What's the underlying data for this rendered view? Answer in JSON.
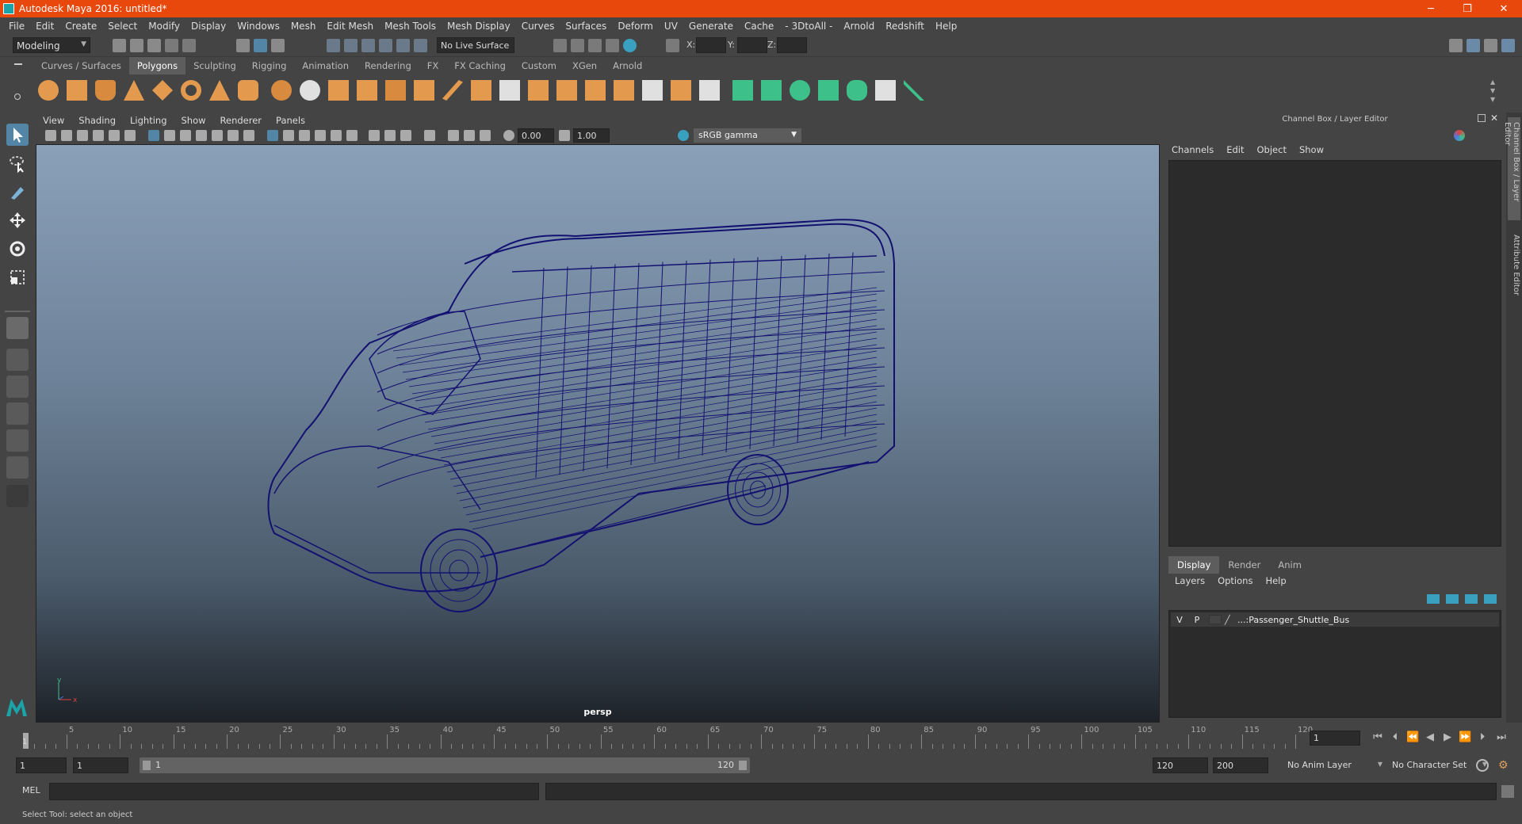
{
  "window": {
    "title": "Autodesk Maya 2016: untitled*",
    "min": "─",
    "restore": "❐",
    "close": "✕"
  },
  "menubar": [
    "File",
    "Edit",
    "Create",
    "Select",
    "Modify",
    "Display",
    "Windows",
    "Mesh",
    "Edit Mesh",
    "Mesh Tools",
    "Mesh Display",
    "Curves",
    "Surfaces",
    "Deform",
    "UV",
    "Generate",
    "Cache",
    "- 3DtoAll -",
    "Arnold",
    "Redshift",
    "Help"
  ],
  "statusline": {
    "mode": "Modeling",
    "live_surface": "No Live Surface",
    "x_label": "X:",
    "y_label": "Y:",
    "z_label": "Z:"
  },
  "shelf": {
    "tabs": [
      "Curves / Surfaces",
      "Polygons",
      "Sculpting",
      "Rigging",
      "Animation",
      "Rendering",
      "FX",
      "FX Caching",
      "Custom",
      "XGen",
      "Arnold"
    ],
    "active_tab": "Polygons"
  },
  "viewport": {
    "menu": [
      "View",
      "Shading",
      "Lighting",
      "Show",
      "Renderer",
      "Panels"
    ],
    "near": "0.00",
    "far": "1.00",
    "color_space": "sRGB gamma",
    "camera": "persp",
    "axis_y": "y",
    "axis_x": "x"
  },
  "channelbox": {
    "title": "Channel Box / Layer Editor",
    "menu": [
      "Channels",
      "Edit",
      "Object",
      "Show"
    ]
  },
  "layereditor": {
    "tabs": [
      "Display",
      "Render",
      "Anim"
    ],
    "active_tab": "Display",
    "menu": [
      "Layers",
      "Options",
      "Help"
    ],
    "layer": {
      "v": "V",
      "p": "P",
      "name": "...:Passenger_Shuttle_Bus"
    }
  },
  "sidetabs": [
    "Channel Box / Layer Editor",
    "Attribute Editor"
  ],
  "timeslider": {
    "ticks": [
      "5",
      "10",
      "15",
      "20",
      "25",
      "30",
      "35",
      "40",
      "45",
      "50",
      "55",
      "60",
      "65",
      "70",
      "75",
      "80",
      "85",
      "90",
      "95",
      "100",
      "105",
      "110",
      "115",
      "120"
    ],
    "start": "1",
    "current": "1"
  },
  "range": {
    "start": "1",
    "inner_start": "1",
    "range_start": "1",
    "range_end": "120",
    "end": "120",
    "max": "200",
    "anim_layer": "No Anim Layer",
    "char_set": "No Character Set"
  },
  "cmd": {
    "label": "MEL"
  },
  "help": "Select Tool: select an object",
  "colors": {
    "title_bg": "#e8480c",
    "wire": "#131170",
    "active": "#5285a6",
    "shelf_orange": "#e39a4e",
    "shelf_green": "#3ec08a"
  }
}
